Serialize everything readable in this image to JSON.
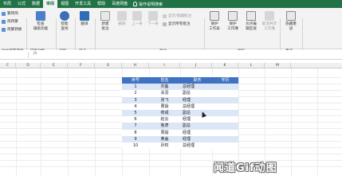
{
  "tabs": [
    "布局",
    "公式",
    "数据",
    "审阅",
    "视图",
    "开发工具",
    "帮助",
    "百度网盘"
  ],
  "active_tab": "审阅",
  "tell_me": "操作说明搜索",
  "ribbon": {
    "chinese": {
      "simp_to_trad": "繁转简",
      "trad_to_simp": "简转繁",
      "convert": "简繁转换",
      "group": "中文简繁转换"
    },
    "accessibility": {
      "label": "检查\n辅助功能",
      "group": "辅助功能"
    },
    "insights": {
      "label": "智能\n查找",
      "group": "见解"
    },
    "language": {
      "label": "翻译",
      "group": "语言"
    },
    "comments": {
      "new": "新建\n批注",
      "delete": "删除",
      "prev": "上一条",
      "next": "下一条",
      "show_hide": "显示/隐藏批注",
      "show_all": "显示所有批注",
      "group": "批注"
    },
    "protect": {
      "sheet": "保护\n工作表",
      "workbook": "保护\n工作簿",
      "allow_edit": "允许编\n辑区域",
      "unshare": "取消共享\n工作簿",
      "group": "保护"
    },
    "ink": {
      "label": "隐藏墨\n迹",
      "group": "墨迹"
    }
  },
  "formula_bar": {
    "fx": "fx"
  },
  "columns": [
    "C",
    "D",
    "E",
    "F",
    "G",
    "H",
    "I",
    "J",
    "K",
    "L",
    "M"
  ],
  "table": {
    "headers": [
      "序号",
      "姓名",
      "职务",
      "学历"
    ],
    "rows": [
      [
        "1",
        "刘备",
        "总经理",
        ""
      ],
      [
        "2",
        "关羽",
        "副总",
        ""
      ],
      [
        "3",
        "张飞",
        "经理",
        ""
      ],
      [
        "4",
        "曹操",
        "总经理",
        ""
      ],
      [
        "5",
        "荀彧",
        "副总",
        ""
      ],
      [
        "6",
        "赵云",
        "经理",
        ""
      ],
      [
        "7",
        "鲁肃",
        "副总",
        ""
      ],
      [
        "8",
        "周瑜",
        "经理",
        ""
      ],
      [
        "9",
        "黄盖",
        "经理",
        ""
      ],
      [
        "10",
        "孙权",
        "总经理",
        ""
      ]
    ]
  },
  "colors": {
    "excel_green": "#217346",
    "table_header": "#3f72c2",
    "band": "#dbe6f6"
  },
  "watermark": "闻道Gif动图"
}
